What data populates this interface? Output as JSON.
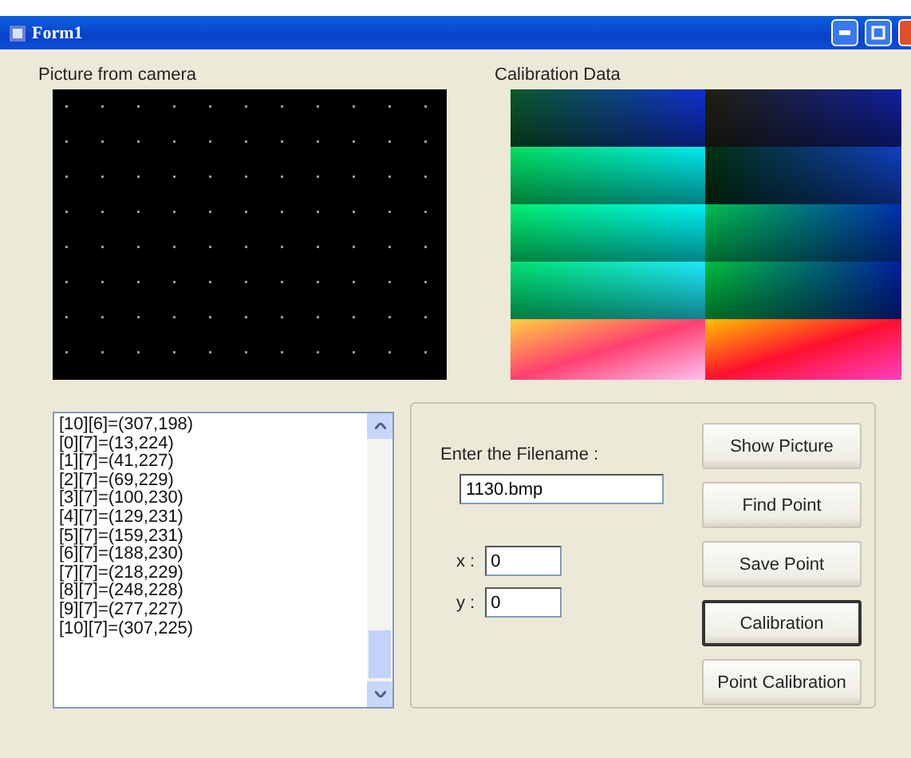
{
  "window": {
    "title": "Form1"
  },
  "camera": {
    "label": "Picture from camera",
    "kind": "picture"
  },
  "calibration": {
    "label": "Calibration Data",
    "kind": "picture"
  },
  "points": [
    "[10][6]=(307,198)",
    "[0][7]=(13,224)",
    "[1][7]=(41,227)",
    "[2][7]=(69,229)",
    "[3][7]=(100,230)",
    "[4][7]=(129,231)",
    "[5][7]=(159,231)",
    "[6][7]=(188,230)",
    "[7][7]=(218,229)",
    "[8][7]=(248,228)",
    "[9][7]=(277,227)",
    "[10][7]=(307,225)"
  ],
  "filename": {
    "label": "Enter the Filename :",
    "value": "1130.bmp"
  },
  "coords": [
    {
      "label": "x :",
      "value": "0"
    },
    {
      "label": "y :",
      "value": "0"
    }
  ],
  "buttons": [
    {
      "label": "Show Picture",
      "focused": false
    },
    {
      "label": "Find Point",
      "focused": false
    },
    {
      "label": "Save Point",
      "focused": false
    },
    {
      "label": "Calibration",
      "focused": true
    },
    {
      "label": "Point Calibration",
      "focused": false
    }
  ]
}
